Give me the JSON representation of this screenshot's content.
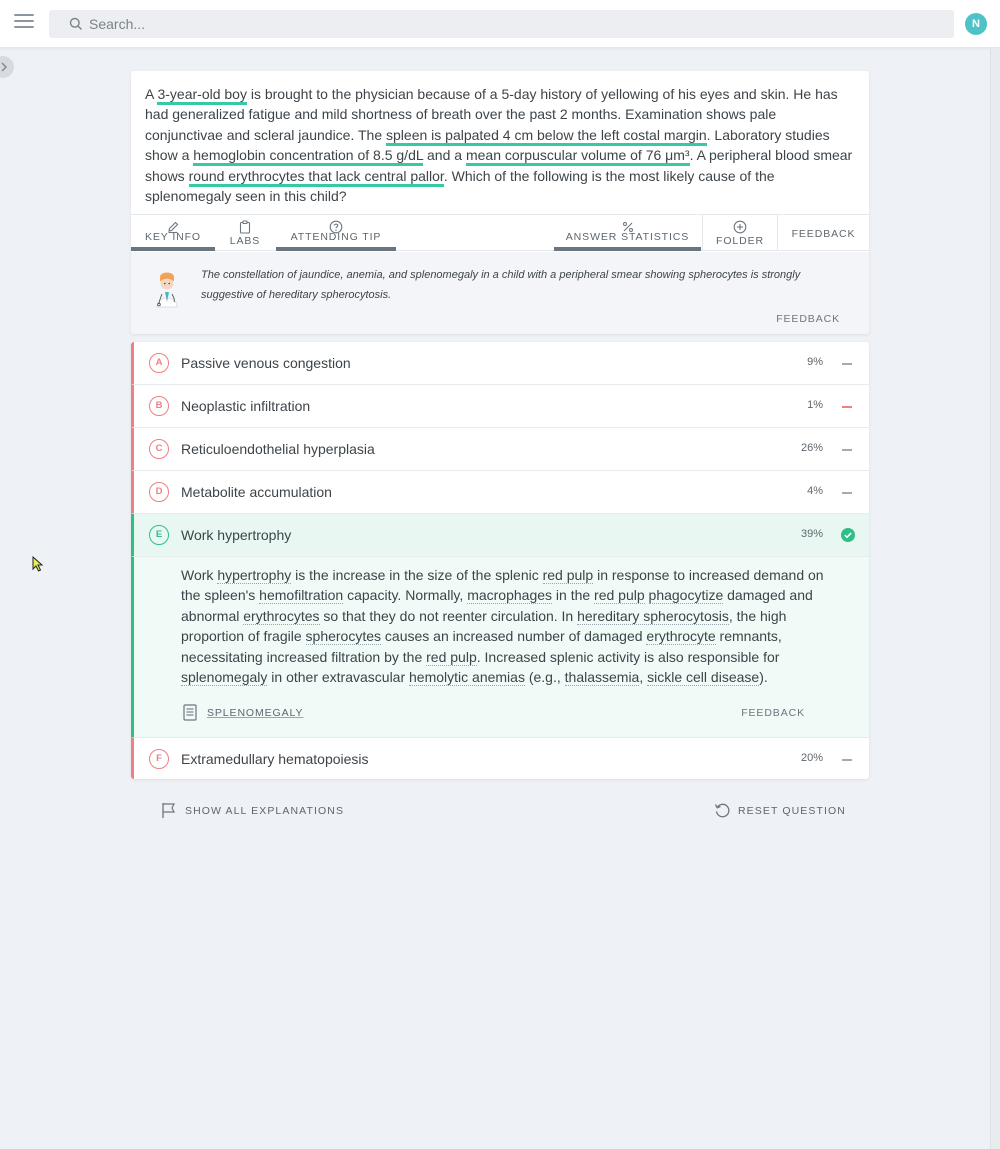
{
  "header": {
    "search_placeholder": "Search...",
    "avatar_initial": "N"
  },
  "question": {
    "parts": [
      "A ",
      "3-year-old boy",
      " is brought to the physician because of a 5-day history of yellowing of his eyes and skin. He has had generalized fatigue and mild shortness of breath over the past 2 months. Examination shows pale conjunctivae and scleral jaundice. The ",
      "spleen is palpated 4 cm below the left costal margin",
      ". Laboratory studies show a ",
      "hemoglobin concentration of 8.5 g/dL",
      " and a ",
      "mean corpuscular volume of 76 μm³",
      ". A peripheral blood smear shows ",
      "round erythrocytes that lack central pallor",
      ". Which of the following is the most likely cause of the splenomegaly seen in this child?"
    ]
  },
  "tabs": {
    "key_info": "KEY INFO",
    "labs": "LABS",
    "attending_tip": "ATTENDING TIP",
    "answer_statistics": "ANSWER STATISTICS",
    "folder": "FOLDER",
    "feedback": "FEEDBACK"
  },
  "tip": {
    "text": "The constellation of jaundice, anemia, and splenomegaly in a child with a peripheral smear showing spherocytes is strongly suggestive of hereditary spherocytosis.",
    "feedback": "FEEDBACK"
  },
  "answers": [
    {
      "letter": "A",
      "text": "Passive venous congestion",
      "pct": "9%"
    },
    {
      "letter": "B",
      "text": "Neoplastic infiltration",
      "pct": "1%"
    },
    {
      "letter": "C",
      "text": "Reticuloendothelial hyperplasia",
      "pct": "26%"
    },
    {
      "letter": "D",
      "text": "Metabolite accumulation",
      "pct": "4%"
    },
    {
      "letter": "E",
      "text": "Work hypertrophy",
      "pct": "39%"
    },
    {
      "letter": "F",
      "text": "Extramedullary hematopoiesis",
      "pct": "20%"
    }
  ],
  "explanation": {
    "parts": [
      "Work ",
      "hypertrophy",
      " is the increase in the size of the splenic ",
      "red pulp",
      " in response to increased demand on the spleen's ",
      "hemofiltration",
      " capacity. Normally, ",
      "macrophages",
      " in the ",
      "red pulp",
      " ",
      "phagocytize",
      " damaged and abnormal ",
      "erythrocytes",
      " so that they do not reenter circulation. In ",
      "hereditary spherocytosis",
      ", the high proportion of fragile ",
      "spherocytes",
      " causes an increased number of damaged ",
      "erythrocyte",
      " remnants, necessitating increased filtration by the ",
      "red pulp",
      ". Increased splenic activity is also responsible for ",
      "splenomegaly",
      " in other extravascular ",
      "hemolytic anemias",
      " (e.g., ",
      "thalassemia",
      ", ",
      "sickle cell disease",
      ")."
    ],
    "article_label": "SPLENOMEGALY",
    "feedback": "FEEDBACK"
  },
  "bottom": {
    "show_all": "SHOW ALL EXPLANATIONS",
    "reset": "RESET QUESTION"
  },
  "colors": {
    "incorrect": "#ef7f83",
    "correct": "#2fbf86",
    "highlight": "#35c9a4",
    "avatar": "#4ec3c7"
  },
  "icons": [
    "menu-icon",
    "search-icon",
    "chevron-right-icon",
    "pencil-icon",
    "clipboard-icon",
    "question-circle-icon",
    "percent-icon",
    "plus-circle-icon",
    "doctor-avatar-icon",
    "check-circle-icon",
    "article-icon",
    "flag-icon",
    "reset-icon",
    "cursor-icon"
  ]
}
